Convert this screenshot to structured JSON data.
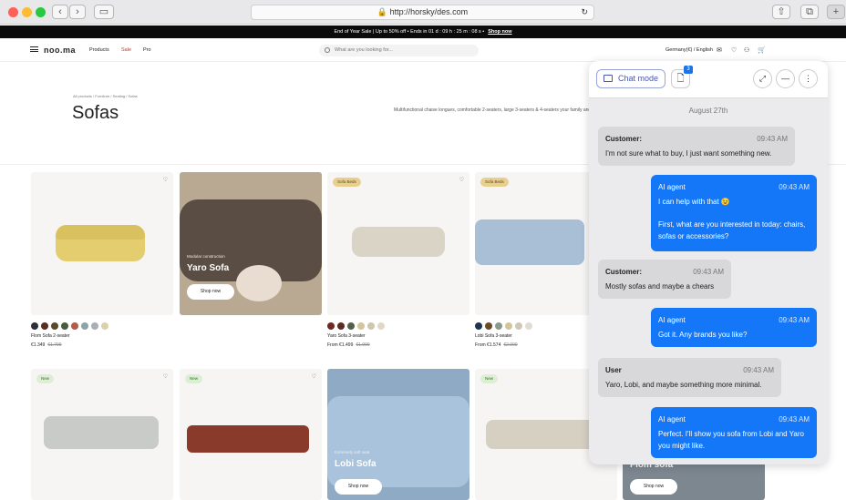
{
  "browser": {
    "url": "http://horsky/des.com"
  },
  "promo": {
    "text": "End of Year Sale | Up to 50% off  •  Ends in  01 d : 09 h : 25 m : 08 s  •",
    "cta": "Shop now"
  },
  "header": {
    "logo": "noo.ma",
    "nav": [
      "Products",
      "Sale",
      "Pro"
    ],
    "search_placeholder": "What are you looking for...",
    "locale": "Germany(€) / English"
  },
  "page": {
    "breadcrumb": "All products / Furniture / Seating / Sofas",
    "title": "Sofas",
    "description": "Multifunctional chaise longues, comfortable 2-seaters, large 3-seaters & 4-seaters your family and friends. Choose the perfect configuration from many different se"
  },
  "products": [
    {
      "name": "Flom Sofa 2-seater",
      "price": "€1.349",
      "old": "€1.799",
      "swatches": [
        "#2e2e36",
        "#5a2c22",
        "#5b4a2a",
        "#4a5a3a",
        "#b55a45",
        "#8aa4a8",
        "#a8aeb4",
        "#dccfae"
      ]
    },
    {
      "overlay_sub": "Modular construction",
      "overlay_title": "Yaro Sofa",
      "cta": "Shop now"
    },
    {
      "name": "Yaro Sofa 3-seater",
      "price": "From €1.499",
      "old": "€1.999",
      "badge": "Sofa Beds",
      "swatches": [
        "#6a2a22",
        "#5a2c22",
        "#55604a",
        "#d4c49a",
        "#cfc6b0",
        "#e0d8c4"
      ]
    },
    {
      "name": "Lobi Sofa 3-seater",
      "price": "From €1.574",
      "old": "€2.099",
      "badge": "Sofa Beds",
      "swatches": [
        "#1f3450",
        "#6a4a2a",
        "#8a9a8a",
        "#d4c49a",
        "#cfc8b8",
        "#e0dcd4"
      ]
    },
    {
      "badge": "New"
    },
    {
      "badge": "New"
    },
    {
      "overlay_sub": "Extremely soft seat",
      "overlay_title": "Lobi Sofa",
      "cta": "Shop now"
    },
    {
      "badge": "New"
    },
    {
      "overlay_title": "Flom sofa",
      "cta": "Shop now"
    }
  ],
  "chat": {
    "mode_label": "Chat mode",
    "doc_count": "3",
    "date": "August 27th",
    "messages": [
      {
        "who": "Customer:",
        "time": "09:43 AM",
        "text": "I'm not sure what to buy, I just want something new."
      },
      {
        "who": "AI agent",
        "time": "09:43 AM",
        "text": "I can help with that 😉",
        "text2": "First, what are you interested in today: chairs, sofas or accessories?"
      },
      {
        "who": "Customer:",
        "time": "09:43 AM",
        "text": "Mostly sofas and maybe a chears"
      },
      {
        "who": "AI agent",
        "time": "09:43 AM",
        "text": "Got it. Any brands you like?"
      },
      {
        "who": "User",
        "time": "09:43 AM",
        "text": "Yaro, Lobi, and maybe something more minimal."
      },
      {
        "who": "AI agent",
        "time": "09:43 AM",
        "text": "Perfect. I'll show you sofa from Lobi and Yaro you might like."
      }
    ]
  },
  "colors": {
    "ai_bubble": "#1477f8",
    "customer_bubble": "#d8d8da"
  }
}
